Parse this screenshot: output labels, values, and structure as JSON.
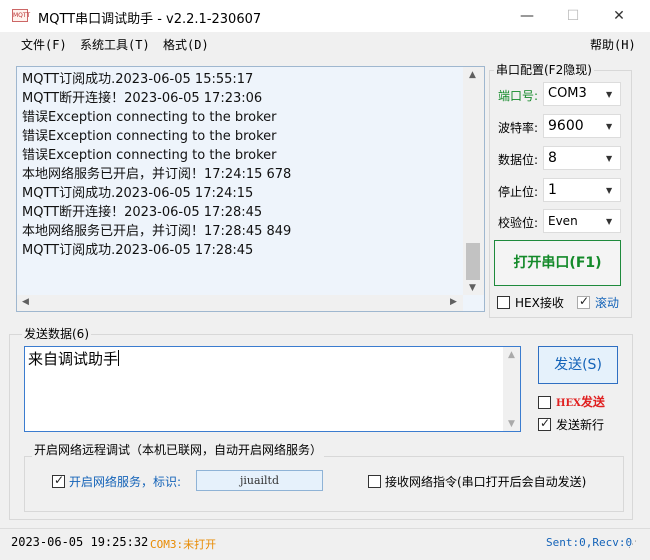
{
  "window": {
    "title": "MQTT串口调试助手 - v2.2.1-230607",
    "icon_label": "MQTT",
    "minimize": "—",
    "maximize": "☐",
    "close": "✕"
  },
  "menu": {
    "file": "文件(F)",
    "system_tools": "系统工具(T)",
    "format": "格式(D)",
    "help": "帮助(H)"
  },
  "receive": {
    "lines": [
      "MQTT订阅成功.2023-06-05 15:55:17",
      "MQTT断开连接！2023-06-05 17:23:06",
      "错误Exception connecting to the broker",
      "错误Exception connecting to the broker",
      "错误Exception connecting to the broker",
      "本地网络服务已开启，并订阅！17:24:15 678",
      "MQTT订阅成功.2023-06-05 17:24:15",
      "MQTT断开连接！2023-06-05 17:28:45",
      "本地网络服务已开启，并订阅！17:28:45 849",
      "MQTT订阅成功.2023-06-05 17:28:45"
    ]
  },
  "serial_config": {
    "title": "串口配置(F2隐现)",
    "port_label": "端口号:",
    "port_value": "COM3",
    "baud_label": "波特率:",
    "baud_value": "9600",
    "databits_label": "数据位:",
    "databits_value": "8",
    "stopbits_label": "停止位:",
    "stopbits_value": "1",
    "parity_label": "校验位:",
    "parity_value": "Even",
    "open_button": "打开串口(F1)",
    "hex_receive_label": "HEX接收",
    "hex_receive_checked": false,
    "scroll_label": "滚动",
    "scroll_checked": true
  },
  "send": {
    "title": "发送数据(6)",
    "text": "来自调试助手",
    "send_button": "发送(S)",
    "hex_send_label": "发送",
    "hex_send_prefix": "HEX",
    "hex_send_checked": false,
    "send_newline_label": "发送新行",
    "send_newline_checked": true
  },
  "network": {
    "title": "开启网络远程调试（本机已联网，自动开启网络服务）",
    "enable_label": "开启网络服务，标识:",
    "enable_checked": true,
    "identifier": "jiuailtd",
    "receive_cmd_label": "接收网络指令(串口打开后会自动发送)",
    "receive_cmd_checked": false
  },
  "status": {
    "datetime": "2023-06-05 19:25:32",
    "port": "COM3",
    "port_state": ":未打开",
    "counters": "Sent:0,Recv:0"
  },
  "colors": {
    "accent_green": "#148a2a",
    "status_orange": "#e88a00",
    "hex_red": "#e02020",
    "link_blue": "#1463b8"
  }
}
